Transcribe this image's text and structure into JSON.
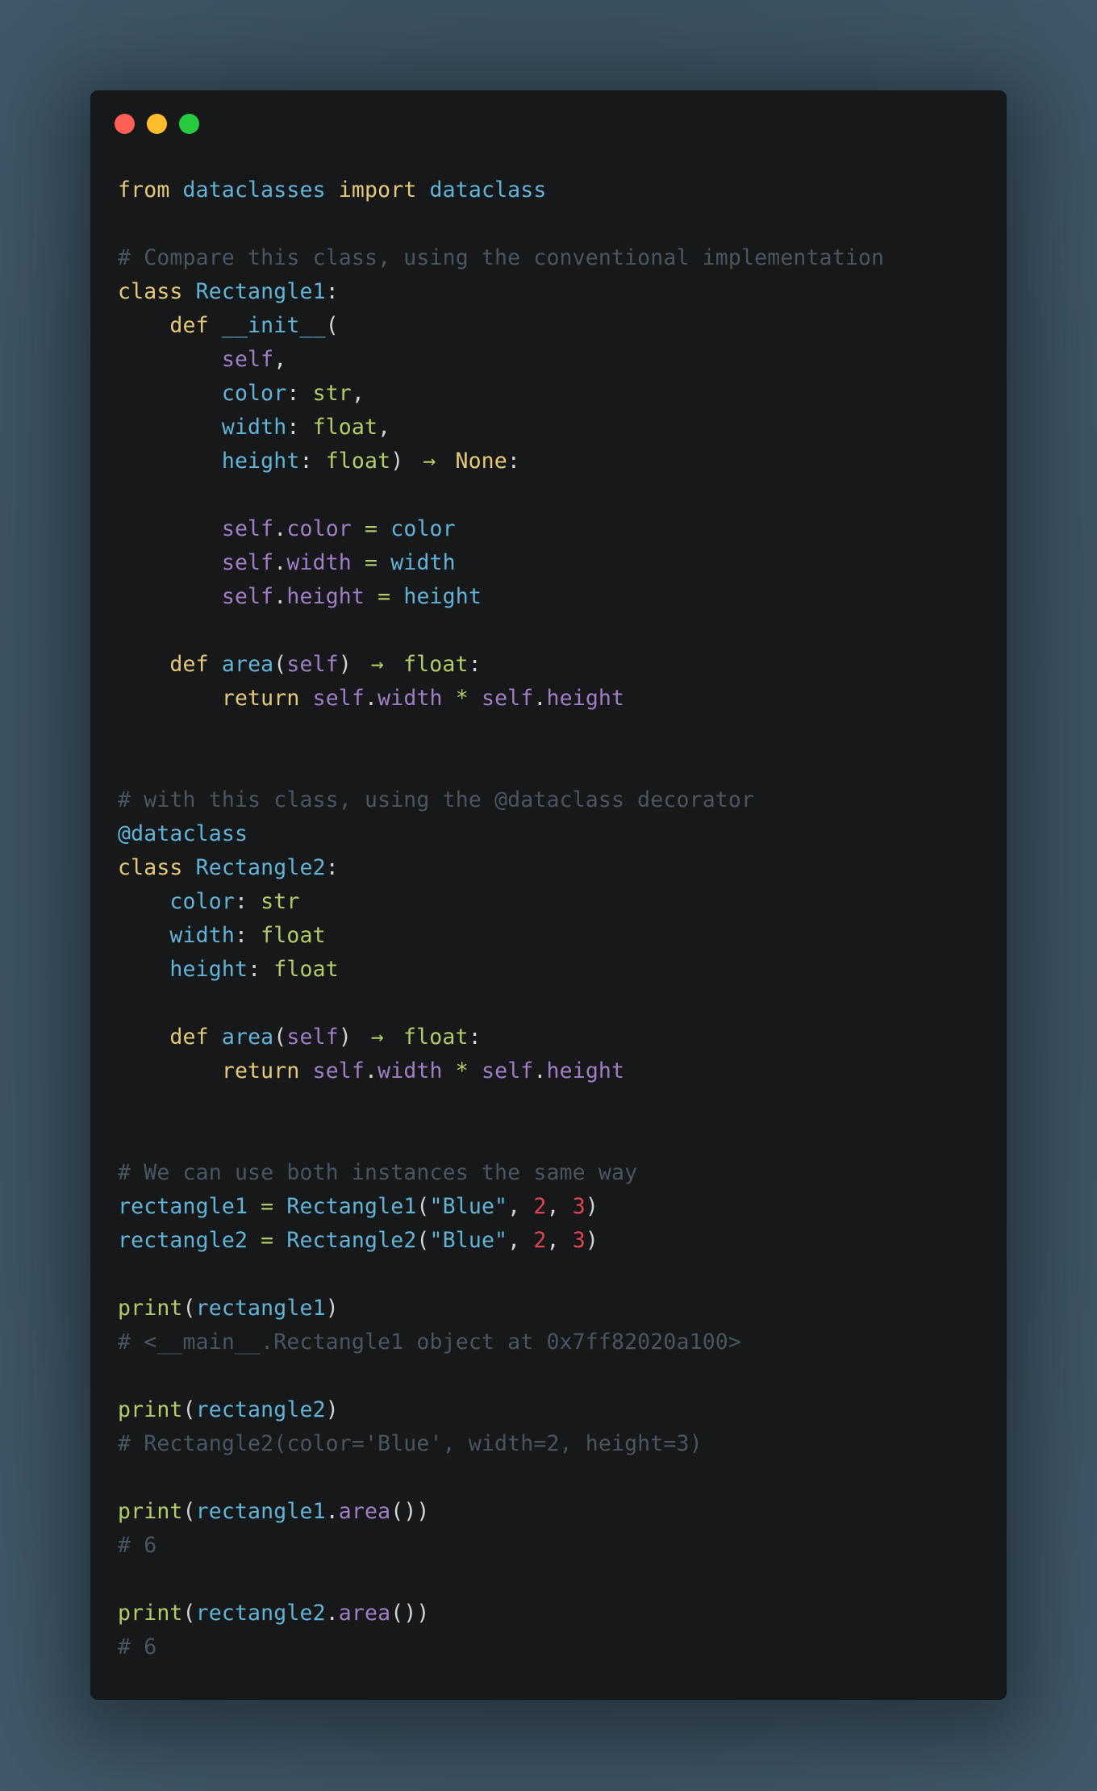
{
  "window": {
    "controls": [
      {
        "name": "close",
        "color": "#ff5f56"
      },
      {
        "name": "minimize",
        "color": "#ffbd2e"
      },
      {
        "name": "maximize",
        "color": "#27c93f"
      }
    ]
  },
  "theme": {
    "keyword": "#e5c97a",
    "name": "#62b3d8",
    "self": "#a07ec6",
    "type": "#b2cc68",
    "number": "#e0454f",
    "comment": "#4a565f",
    "background": "#17181a"
  },
  "code": {
    "language": "python",
    "lines": [
      [
        {
          "t": "from",
          "c": "kw"
        },
        {
          "t": " "
        },
        {
          "t": "dataclasses",
          "c": "name"
        },
        {
          "t": " "
        },
        {
          "t": "import",
          "c": "kw"
        },
        {
          "t": " "
        },
        {
          "t": "dataclass",
          "c": "name"
        }
      ],
      [],
      [
        {
          "t": "# Compare this class, using the conventional implementation",
          "c": "cmt"
        }
      ],
      [
        {
          "t": "class",
          "c": "kw"
        },
        {
          "t": " "
        },
        {
          "t": "Rectangle1",
          "c": "name"
        },
        {
          "t": ":",
          "c": "punc"
        }
      ],
      [
        {
          "t": "    "
        },
        {
          "t": "def",
          "c": "kw"
        },
        {
          "t": " "
        },
        {
          "t": "__init__",
          "c": "name"
        },
        {
          "t": "(",
          "c": "punc"
        }
      ],
      [
        {
          "t": "        "
        },
        {
          "t": "self",
          "c": "self"
        },
        {
          "t": ",",
          "c": "punc"
        }
      ],
      [
        {
          "t": "        "
        },
        {
          "t": "color",
          "c": "name"
        },
        {
          "t": ": ",
          "c": "punc"
        },
        {
          "t": "str",
          "c": "type"
        },
        {
          "t": ",",
          "c": "punc"
        }
      ],
      [
        {
          "t": "        "
        },
        {
          "t": "width",
          "c": "name"
        },
        {
          "t": ": ",
          "c": "punc"
        },
        {
          "t": "float",
          "c": "type"
        },
        {
          "t": ",",
          "c": "punc"
        }
      ],
      [
        {
          "t": "        "
        },
        {
          "t": "height",
          "c": "name"
        },
        {
          "t": ": ",
          "c": "punc"
        },
        {
          "t": "float",
          "c": "type"
        },
        {
          "t": ")",
          "c": "punc"
        },
        {
          "t": " "
        },
        {
          "t": "→",
          "c": "op",
          "arrow": true
        },
        {
          "t": " "
        },
        {
          "t": "None",
          "c": "kw"
        },
        {
          "t": ":",
          "c": "punc"
        }
      ],
      [],
      [
        {
          "t": "        "
        },
        {
          "t": "self",
          "c": "self"
        },
        {
          "t": ".",
          "c": "punc"
        },
        {
          "t": "color",
          "c": "self"
        },
        {
          "t": " "
        },
        {
          "t": "=",
          "c": "op"
        },
        {
          "t": " "
        },
        {
          "t": "color",
          "c": "name"
        }
      ],
      [
        {
          "t": "        "
        },
        {
          "t": "self",
          "c": "self"
        },
        {
          "t": ".",
          "c": "punc"
        },
        {
          "t": "width",
          "c": "self"
        },
        {
          "t": " "
        },
        {
          "t": "=",
          "c": "op"
        },
        {
          "t": " "
        },
        {
          "t": "width",
          "c": "name"
        }
      ],
      [
        {
          "t": "        "
        },
        {
          "t": "self",
          "c": "self"
        },
        {
          "t": ".",
          "c": "punc"
        },
        {
          "t": "height",
          "c": "self"
        },
        {
          "t": " "
        },
        {
          "t": "=",
          "c": "op"
        },
        {
          "t": " "
        },
        {
          "t": "height",
          "c": "name"
        }
      ],
      [],
      [
        {
          "t": "    "
        },
        {
          "t": "def",
          "c": "kw"
        },
        {
          "t": " "
        },
        {
          "t": "area",
          "c": "name"
        },
        {
          "t": "(",
          "c": "punc"
        },
        {
          "t": "self",
          "c": "self"
        },
        {
          "t": ")",
          "c": "punc"
        },
        {
          "t": " "
        },
        {
          "t": "→",
          "c": "op",
          "arrow": true
        },
        {
          "t": " "
        },
        {
          "t": "float",
          "c": "type"
        },
        {
          "t": ":",
          "c": "punc"
        }
      ],
      [
        {
          "t": "        "
        },
        {
          "t": "return",
          "c": "kw"
        },
        {
          "t": " "
        },
        {
          "t": "self",
          "c": "self"
        },
        {
          "t": ".",
          "c": "punc"
        },
        {
          "t": "width",
          "c": "self"
        },
        {
          "t": " "
        },
        {
          "t": "*",
          "c": "op"
        },
        {
          "t": " "
        },
        {
          "t": "self",
          "c": "self"
        },
        {
          "t": ".",
          "c": "punc"
        },
        {
          "t": "height",
          "c": "self"
        }
      ],
      [],
      [],
      [
        {
          "t": "# with this class, using the @dataclass decorator",
          "c": "cmt"
        }
      ],
      [
        {
          "t": "@dataclass",
          "c": "name"
        }
      ],
      [
        {
          "t": "class",
          "c": "kw"
        },
        {
          "t": " "
        },
        {
          "t": "Rectangle2",
          "c": "name"
        },
        {
          "t": ":",
          "c": "punc"
        }
      ],
      [
        {
          "t": "    "
        },
        {
          "t": "color",
          "c": "name"
        },
        {
          "t": ": ",
          "c": "punc"
        },
        {
          "t": "str",
          "c": "type"
        }
      ],
      [
        {
          "t": "    "
        },
        {
          "t": "width",
          "c": "name"
        },
        {
          "t": ": ",
          "c": "punc"
        },
        {
          "t": "float",
          "c": "type"
        }
      ],
      [
        {
          "t": "    "
        },
        {
          "t": "height",
          "c": "name"
        },
        {
          "t": ": ",
          "c": "punc"
        },
        {
          "t": "float",
          "c": "type"
        }
      ],
      [],
      [
        {
          "t": "    "
        },
        {
          "t": "def",
          "c": "kw"
        },
        {
          "t": " "
        },
        {
          "t": "area",
          "c": "name"
        },
        {
          "t": "(",
          "c": "punc"
        },
        {
          "t": "self",
          "c": "self"
        },
        {
          "t": ")",
          "c": "punc"
        },
        {
          "t": " "
        },
        {
          "t": "→",
          "c": "op",
          "arrow": true
        },
        {
          "t": " "
        },
        {
          "t": "float",
          "c": "type"
        },
        {
          "t": ":",
          "c": "punc"
        }
      ],
      [
        {
          "t": "        "
        },
        {
          "t": "return",
          "c": "kw"
        },
        {
          "t": " "
        },
        {
          "t": "self",
          "c": "self"
        },
        {
          "t": ".",
          "c": "punc"
        },
        {
          "t": "width",
          "c": "self"
        },
        {
          "t": " "
        },
        {
          "t": "*",
          "c": "op"
        },
        {
          "t": " "
        },
        {
          "t": "self",
          "c": "self"
        },
        {
          "t": ".",
          "c": "punc"
        },
        {
          "t": "height",
          "c": "self"
        }
      ],
      [],
      [],
      [
        {
          "t": "# We can use both instances the same way",
          "c": "cmt"
        }
      ],
      [
        {
          "t": "rectangle1",
          "c": "name"
        },
        {
          "t": " "
        },
        {
          "t": "=",
          "c": "op"
        },
        {
          "t": " "
        },
        {
          "t": "Rectangle1",
          "c": "name"
        },
        {
          "t": "(",
          "c": "punc"
        },
        {
          "t": "\"Blue\"",
          "c": "str"
        },
        {
          "t": ", ",
          "c": "punc"
        },
        {
          "t": "2",
          "c": "num"
        },
        {
          "t": ", ",
          "c": "punc"
        },
        {
          "t": "3",
          "c": "num"
        },
        {
          "t": ")",
          "c": "punc"
        }
      ],
      [
        {
          "t": "rectangle2",
          "c": "name"
        },
        {
          "t": " "
        },
        {
          "t": "=",
          "c": "op"
        },
        {
          "t": " "
        },
        {
          "t": "Rectangle2",
          "c": "name"
        },
        {
          "t": "(",
          "c": "punc"
        },
        {
          "t": "\"Blue\"",
          "c": "str"
        },
        {
          "t": ", ",
          "c": "punc"
        },
        {
          "t": "2",
          "c": "num"
        },
        {
          "t": ", ",
          "c": "punc"
        },
        {
          "t": "3",
          "c": "num"
        },
        {
          "t": ")",
          "c": "punc"
        }
      ],
      [],
      [
        {
          "t": "print",
          "c": "type"
        },
        {
          "t": "(",
          "c": "punc"
        },
        {
          "t": "rectangle1",
          "c": "name"
        },
        {
          "t": ")",
          "c": "punc"
        }
      ],
      [
        {
          "t": "# <__main__.Rectangle1 object at 0x7ff82020a100>",
          "c": "cmt"
        }
      ],
      [],
      [
        {
          "t": "print",
          "c": "type"
        },
        {
          "t": "(",
          "c": "punc"
        },
        {
          "t": "rectangle2",
          "c": "name"
        },
        {
          "t": ")",
          "c": "punc"
        }
      ],
      [
        {
          "t": "# Rectangle2(color='Blue', width=2, height=3)",
          "c": "cmt"
        }
      ],
      [],
      [
        {
          "t": "print",
          "c": "type"
        },
        {
          "t": "(",
          "c": "punc"
        },
        {
          "t": "rectangle1",
          "c": "name"
        },
        {
          "t": ".",
          "c": "punc"
        },
        {
          "t": "area",
          "c": "self"
        },
        {
          "t": "())",
          "c": "punc"
        }
      ],
      [
        {
          "t": "# 6",
          "c": "cmt"
        }
      ],
      [],
      [
        {
          "t": "print",
          "c": "type"
        },
        {
          "t": "(",
          "c": "punc"
        },
        {
          "t": "rectangle2",
          "c": "name"
        },
        {
          "t": ".",
          "c": "punc"
        },
        {
          "t": "area",
          "c": "self"
        },
        {
          "t": "())",
          "c": "punc"
        }
      ],
      [
        {
          "t": "# 6",
          "c": "cmt"
        }
      ]
    ]
  }
}
